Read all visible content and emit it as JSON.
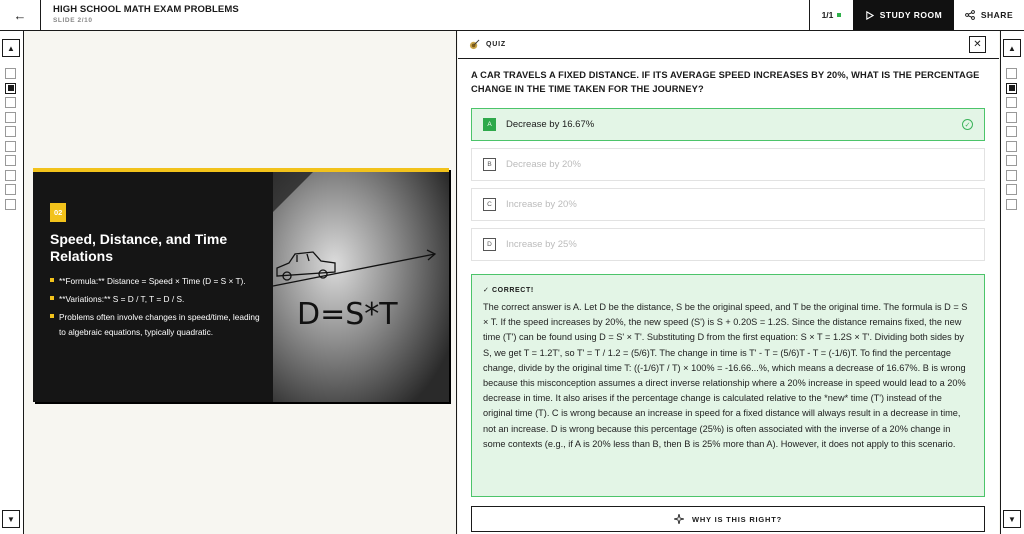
{
  "header": {
    "back_icon": "arrow-left-icon",
    "title": "HIGH SCHOOL MATH EXAM PROBLEMS",
    "subtitle": "SLIDE 2/10",
    "counter": "1/1",
    "counter_dot_color": "#2fb14b",
    "study_room_label": "STUDY ROOM",
    "study_room_icon": "play-icon",
    "share_label": "SHARE",
    "share_icon": "share-icon"
  },
  "rails": {
    "up_icon": "chevron-up-icon",
    "down_icon": "chevron-down-icon",
    "box_count": 10,
    "active_index": 1
  },
  "slide": {
    "number": "02",
    "title": "Speed, Distance, and Time Relations",
    "bullets": [
      "**Formula:** Distance = Speed × Time (D = S × T).",
      "**Variations:** S = D / T, T = D / S.",
      "Problems often involve changes in speed/time, leading to algebraic equations, typically quadratic."
    ],
    "photo_text": "D=S*T",
    "accent_color": "#f2c21b"
  },
  "quiz": {
    "label": "QUIZ",
    "question": "A CAR TRAVELS A FIXED DISTANCE. IF ITS AVERAGE SPEED INCREASES BY 20%, WHAT IS THE PERCENTAGE CHANGE IN THE TIME TAKEN FOR THE JOURNEY?",
    "options": [
      {
        "letter": "A",
        "text": "Decrease by 16.67%",
        "correct": true
      },
      {
        "letter": "B",
        "text": "Decrease by 20%",
        "correct": false
      },
      {
        "letter": "C",
        "text": "Increase by 20%",
        "correct": false
      },
      {
        "letter": "D",
        "text": "Increase by 25%",
        "correct": false
      }
    ],
    "result_label": "✓ CORRECT!",
    "explanation": "The correct answer is A. Let D be the distance, S be the original speed, and T be the original time. The formula is D = S × T. If the speed increases by 20%, the new speed (S') is S + 0.20S = 1.2S. Since the distance remains fixed, the new time (T') can be found using D = S' × T'. Substituting D from the first equation: S × T = 1.2S × T'. Dividing both sides by S, we get T = 1.2T', so T' = T / 1.2 = (5/6)T. The change in time is T' - T = (5/6)T - T = (-1/6)T. To find the percentage change, divide by the original time T: ((-1/6)T / T) × 100% = -16.66...%, which means a decrease of 16.67%. B is wrong because this misconception assumes a direct inverse relationship where a 20% increase in speed would lead to a 20% decrease in time. It also arises if the percentage change is calculated relative to the *new* time (T') instead of the original time (T). C is wrong because an increase in speed for a fixed distance will always result in a decrease in time, not an increase. D is wrong because this percentage (25%) is often associated with the inverse of a 20% change in some contexts (e.g., if A is 20% less than B, then B is 25% more than A). However, it does not apply to this scenario.",
    "why_label": "WHY IS THIS RIGHT?",
    "why_icon": "sparkle-icon",
    "correct_color": "#2ea94b"
  }
}
